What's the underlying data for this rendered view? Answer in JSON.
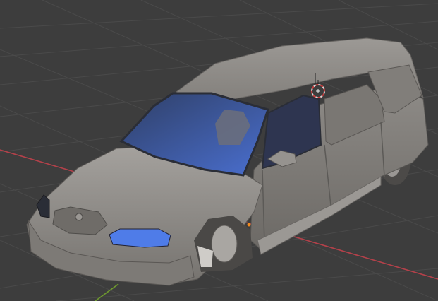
{
  "viewport": {
    "background": "#3d3d3d",
    "grid_color": "#4a4a4a",
    "x_axis_color": "#b4414a",
    "y_axis_color": "#6f9a2e"
  },
  "scene": {
    "object": "car-model",
    "body_color": "#8c8985",
    "glass_color": "#4a6fd0",
    "headlight_color": "#4f7ce8",
    "origin_color": "#f28a1e"
  },
  "cursor": {
    "icon": "3d-cursor-icon",
    "ring_colors": [
      "#d8d8d8",
      "#c83a3a"
    ]
  }
}
